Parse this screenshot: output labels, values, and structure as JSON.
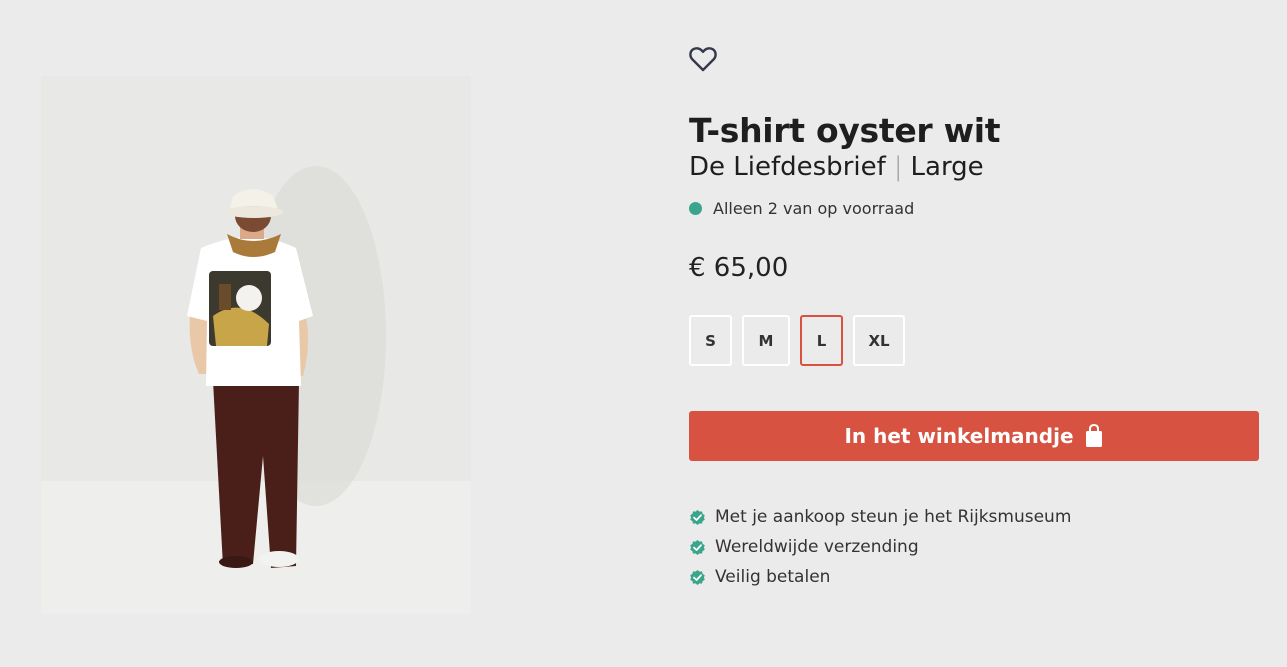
{
  "product": {
    "title": "T-shirt oyster wit",
    "artwork": "De Liefdesbrief",
    "separator": "|",
    "size_label": "Large",
    "stock_text": "Alleen 2 van op voorraad",
    "price": "€ 65,00"
  },
  "sizes": {
    "s": "S",
    "m": "M",
    "l": "L",
    "xl": "XL",
    "selected": "L"
  },
  "cart": {
    "button_label": "In het winkelmandje"
  },
  "usps": {
    "item_1": "Met je aankoop steun je het Rijksmuseum",
    "item_2": "Wereldwijde verzending",
    "item_3": "Veilig betalen"
  },
  "colors": {
    "accent": "#d75240",
    "stock_green": "#3aa58a",
    "background": "#ebebeb"
  },
  "icons": {
    "favorite": "heart-icon",
    "cart": "shopping-bag-icon",
    "check": "check-icon",
    "stock": "status-dot-icon"
  }
}
